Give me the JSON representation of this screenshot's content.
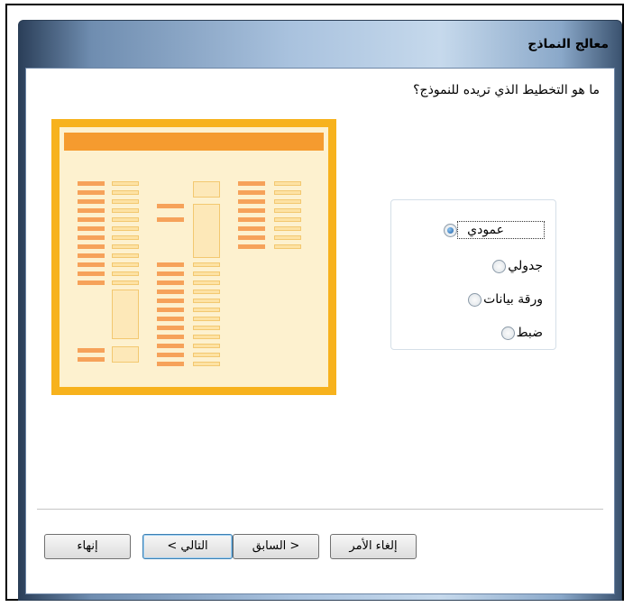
{
  "window": {
    "title": "معالج النماذج"
  },
  "question": "ما هو التخطيط الذي تريده للنموذج؟",
  "layout_options": [
    {
      "label": "عمودي",
      "selected": true
    },
    {
      "label": "جدولي",
      "selected": false
    },
    {
      "label": "ورقة بيانات",
      "selected": false
    },
    {
      "label": "ضبط",
      "selected": false
    }
  ],
  "buttons": {
    "cancel": "إلغاء الأمر",
    "back": "< السابق",
    "next": "التالي >",
    "finish": "إنهاء"
  },
  "colors": {
    "preview_border": "#f7b21d",
    "preview_header": "#f59b2f",
    "title_bar": "#a9c2de"
  }
}
